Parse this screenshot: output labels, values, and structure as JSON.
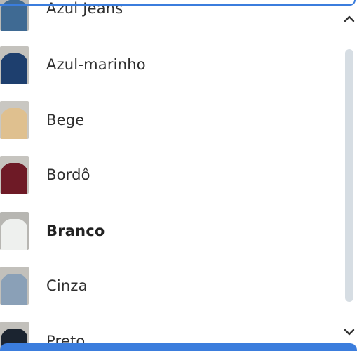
{
  "dropdown": {
    "options": [
      {
        "label": "Azul Jeans",
        "color": "#3f6a93"
      },
      {
        "label": "Azul-marinho",
        "color": "#1e3f6e"
      },
      {
        "label": "Bege",
        "color": "#dfc08f"
      },
      {
        "label": "Bordô",
        "color": "#6e1a26"
      },
      {
        "label": "Branco",
        "color": "#eef0ee",
        "selected": true
      },
      {
        "label": "Cinza",
        "color": "#8aa0b7"
      },
      {
        "label": "Preto",
        "color": "#1b2430"
      }
    ]
  },
  "icons": {
    "scroll_up": "chevron-up-icon",
    "scroll_down": "chevron-down-icon"
  },
  "colors": {
    "accent": "#3b7ddd",
    "scrollbar": "#d6dde3"
  }
}
